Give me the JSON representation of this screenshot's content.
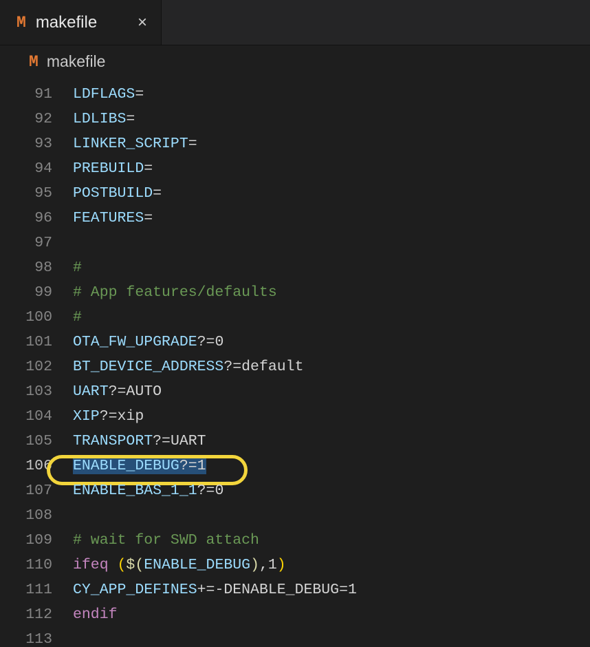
{
  "tab": {
    "icon_letter": "M",
    "title": "makefile",
    "close_glyph": "×"
  },
  "breadcrumb": {
    "icon_letter": "M",
    "title": "makefile"
  },
  "editor": {
    "lines": [
      {
        "num": 91,
        "tokens": [
          [
            "tok-var",
            "LDFLAGS"
          ],
          [
            "tok-op",
            "="
          ]
        ]
      },
      {
        "num": 92,
        "tokens": [
          [
            "tok-var",
            "LDLIBS"
          ],
          [
            "tok-op",
            "="
          ]
        ]
      },
      {
        "num": 93,
        "tokens": [
          [
            "tok-var",
            "LINKER_SCRIPT"
          ],
          [
            "tok-op",
            "="
          ]
        ]
      },
      {
        "num": 94,
        "tokens": [
          [
            "tok-var",
            "PREBUILD"
          ],
          [
            "tok-op",
            "="
          ]
        ]
      },
      {
        "num": 95,
        "tokens": [
          [
            "tok-var",
            "POSTBUILD"
          ],
          [
            "tok-op",
            "="
          ]
        ]
      },
      {
        "num": 96,
        "tokens": [
          [
            "tok-var",
            "FEATURES"
          ],
          [
            "tok-op",
            "="
          ]
        ]
      },
      {
        "num": 97,
        "tokens": []
      },
      {
        "num": 98,
        "tokens": [
          [
            "tok-comment",
            "#"
          ]
        ]
      },
      {
        "num": 99,
        "tokens": [
          [
            "tok-comment",
            "# App features/defaults"
          ]
        ]
      },
      {
        "num": 100,
        "tokens": [
          [
            "tok-comment",
            "#"
          ]
        ]
      },
      {
        "num": 101,
        "tokens": [
          [
            "tok-var",
            "OTA_FW_UPGRADE"
          ],
          [
            "tok-op",
            "?="
          ],
          [
            "tok-val",
            "0"
          ]
        ]
      },
      {
        "num": 102,
        "tokens": [
          [
            "tok-var",
            "BT_DEVICE_ADDRESS"
          ],
          [
            "tok-op",
            "?="
          ],
          [
            "tok-val",
            "default"
          ]
        ]
      },
      {
        "num": 103,
        "tokens": [
          [
            "tok-var",
            "UART"
          ],
          [
            "tok-op",
            "?="
          ],
          [
            "tok-val",
            "AUTO"
          ]
        ]
      },
      {
        "num": 104,
        "tokens": [
          [
            "tok-var",
            "XIP"
          ],
          [
            "tok-op",
            "?="
          ],
          [
            "tok-val",
            "xip"
          ]
        ]
      },
      {
        "num": 105,
        "tokens": [
          [
            "tok-var",
            "TRANSPORT"
          ],
          [
            "tok-op",
            "?="
          ],
          [
            "tok-val",
            "UART"
          ]
        ]
      },
      {
        "num": 106,
        "current": true,
        "circle": true,
        "selected": true,
        "tokens": [
          [
            "tok-var",
            "ENABLE_DEBUG"
          ],
          [
            "tok-op",
            "?="
          ],
          [
            "tok-val",
            "1"
          ]
        ]
      },
      {
        "num": 107,
        "tokens": [
          [
            "tok-var",
            "ENABLE_BAS_1_1"
          ],
          [
            "tok-op",
            "?="
          ],
          [
            "tok-val",
            "0"
          ]
        ]
      },
      {
        "num": 108,
        "tokens": []
      },
      {
        "num": 109,
        "tokens": [
          [
            "tok-comment",
            "# wait for SWD attach"
          ]
        ]
      },
      {
        "num": 110,
        "tokens": [
          [
            "tok-keyword",
            "ifeq "
          ],
          [
            "tok-punc-yellow",
            "("
          ],
          [
            "tok-func",
            "$("
          ],
          [
            "tok-var",
            "ENABLE_DEBUG"
          ],
          [
            "tok-func",
            ")"
          ],
          [
            "tok-op",
            ",1"
          ],
          [
            "tok-punc-yellow",
            ")"
          ]
        ]
      },
      {
        "num": 111,
        "tokens": [
          [
            "tok-var",
            "CY_APP_DEFINES"
          ],
          [
            "tok-op",
            "+=-DENABLE_DEBUG=1"
          ]
        ]
      },
      {
        "num": 112,
        "tokens": [
          [
            "tok-keyword",
            "endif"
          ]
        ]
      },
      {
        "num": 113,
        "tokens": []
      }
    ]
  }
}
